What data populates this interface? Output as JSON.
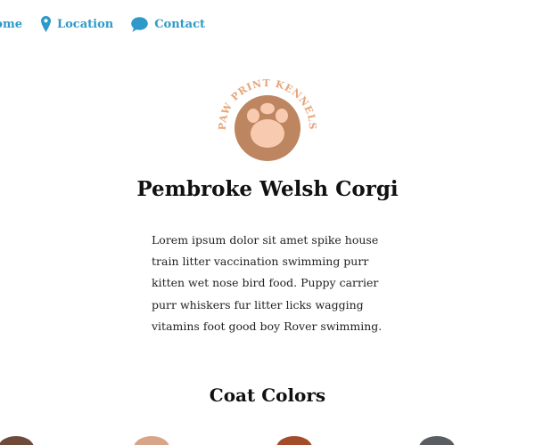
{
  "nav": {
    "items": [
      {
        "label": "Home",
        "icon": "home-icon"
      },
      {
        "label": "Location",
        "icon": "map-pin-icon"
      },
      {
        "label": "Contact",
        "icon": "speech-bubble-icon"
      }
    ]
  },
  "logo": {
    "text": "PAW PRINT KENNELS",
    "colors": {
      "ring_text": "#e8a57a",
      "circle": "#bd8560",
      "paw": "#f8cbb0"
    }
  },
  "main": {
    "title": "Pembroke Welsh Corgi",
    "description": "Lorem ipsum dolor sit amet spike house train litter vaccination swimming purr kitten wet nose bird food. Puppy carrier purr whiskers fur litter licks wagging vitamins foot good boy Rover swimming."
  },
  "coat_colors": {
    "heading": "Coat Colors",
    "swatches": [
      {
        "name": "dark-brown",
        "color": "#6d4a3a"
      },
      {
        "name": "tan",
        "color": "#d8a48a"
      },
      {
        "name": "red",
        "color": "#a24c2a"
      },
      {
        "name": "gray",
        "color": "#5a5e63"
      }
    ]
  },
  "accent": "#2d9ac9"
}
